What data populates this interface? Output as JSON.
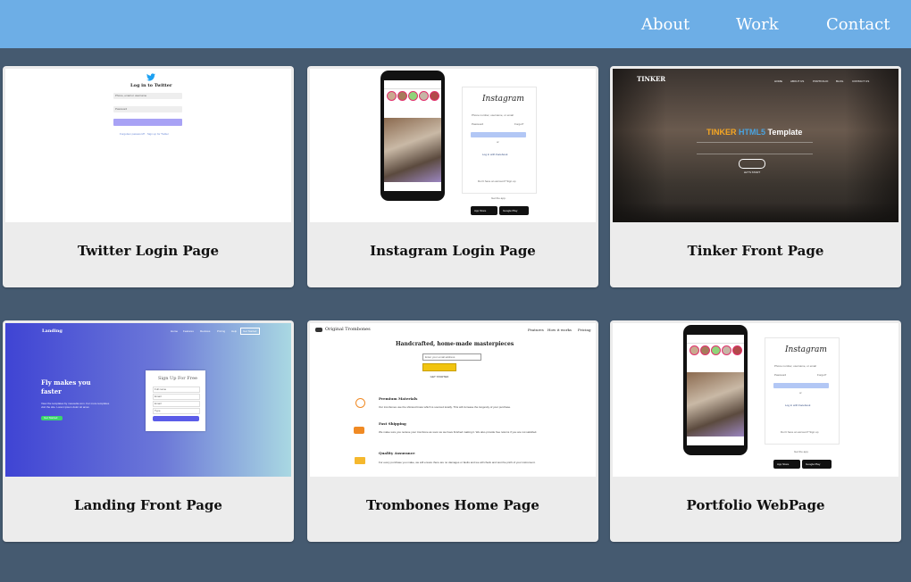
{
  "nav": {
    "about": "About",
    "work": "Work",
    "contact": "Contact"
  },
  "colors": {
    "header": "#6daee6",
    "background": "#455a70",
    "card": "#ececec"
  },
  "cards": [
    {
      "title": "Twitter Login Page",
      "thumb": {
        "heading": "Log in to Twitter",
        "phone_placeholder": "Phone, email or username",
        "password_placeholder": "Password",
        "login_label": "Log in",
        "links": "Forgotten password? · Sign up for Twitter"
      }
    },
    {
      "title": "Instagram Login Page",
      "thumb": {
        "brand": "Instagram",
        "phone_placeholder": "Phone number, username, or email",
        "password_placeholder": "Password",
        "forgot": "Forgot?",
        "login_label": "Log in",
        "or": "or",
        "facebook": "Log in with Facebook",
        "signup": "Don't have an account? Sign up",
        "get_app": "Get the app.",
        "app_store": "App Store",
        "google_play": "Google Play"
      }
    },
    {
      "title": "Tinker Front Page",
      "thumb": {
        "logo": "TINKER",
        "menu": [
          "HOME",
          "ABOUT US",
          "PORTFOLIO",
          "BLOG",
          "CONTACT US"
        ],
        "headline_1": "TINKER",
        "headline_2": "HTML5",
        "headline_3": "Template",
        "cta": "LET'S START"
      }
    },
    {
      "title": "Landing Front Page",
      "thumb": {
        "brand": "Landing",
        "menu": [
          "Home",
          "Features",
          "Reviews",
          "Pricing",
          "Help",
          "Get Started"
        ],
        "hero": "Fly makes you faster",
        "hero_sub": "View the templates by mesoulia.com. For more templates visit the site. Lorem ipsum dolor sit amet.",
        "hero_button": "Get Started",
        "form_title": "Sign Up For Free",
        "form_fields": [
          "Full name",
          "Email",
          "Email",
          "Type"
        ],
        "form_button": "Register"
      }
    },
    {
      "title": "Trombones Home Page",
      "thumb": {
        "brand": "Original Trombones",
        "menu": [
          "Features",
          "How it works",
          "Pricing"
        ],
        "headline": "Handcrafted, home-made masterpieces",
        "email_placeholder": "Enter your email address",
        "cta": "GET STARTED",
        "features": [
          {
            "title": "Premium Materials",
            "text": "Our trombones use the shiniest brass which is sourced locally. This will increase the longevity of your purchase."
          },
          {
            "title": "Fast Shipping",
            "text": "We make sure you recieve your trombone as soon as we have finished making it. We also provide free returns if you are not satisfied."
          },
          {
            "title": "Quality Assurance",
            "text": "For every purchase you make, we will ensure there are no damages or faults and we will check and test the pitch of your instrument."
          }
        ]
      }
    },
    {
      "title": "Portfolio WebPage",
      "thumb": {
        "brand": "Instagram",
        "phone_placeholder": "Phone number, username, or email",
        "password_placeholder": "Password",
        "forgot": "Forgot?",
        "login_label": "Log in",
        "or": "or",
        "facebook": "Log in with Facebook",
        "signup": "Don't have an account? Sign up",
        "get_app": "Get the app.",
        "app_store": "App Store",
        "google_play": "Google Play"
      }
    }
  ]
}
